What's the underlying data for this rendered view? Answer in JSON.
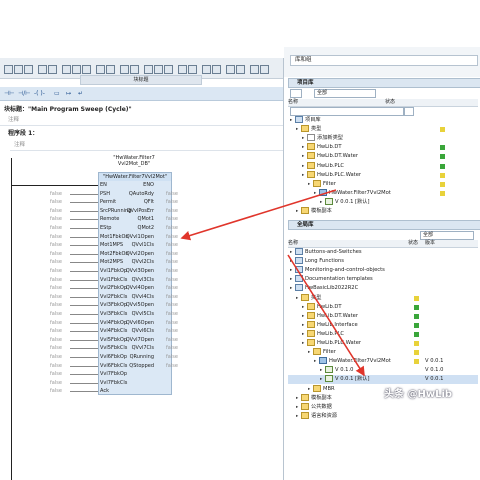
{
  "left_panel": {
    "block_header_label": "块标题",
    "block_title": "块标题：\"Main Program Sweep (Cycle)\"",
    "block_comment": "注释",
    "network_title": "程序段 1：",
    "network_comment": "注释",
    "instance_db_line1": "\"HwWater.Filter7",
    "instance_db_line2": "Vvl2Mot_DB\"",
    "fb_name": "\"HwWater.Filter7Vvl2Mot\"",
    "left_pins": [
      {
        "name": "EN",
        "value": ""
      },
      {
        "name": "PSH",
        "value": "false"
      },
      {
        "name": "Permit",
        "value": "false"
      },
      {
        "name": "SrcPRunning",
        "value": "false"
      },
      {
        "name": "Remote",
        "value": "false"
      },
      {
        "name": "EStp",
        "value": "false"
      },
      {
        "name": "Mot1FbkOn",
        "value": "false"
      },
      {
        "name": "Mot1MPS",
        "value": "false"
      },
      {
        "name": "Mot2FbkOn",
        "value": "false"
      },
      {
        "name": "Mot2MPS",
        "value": "false"
      },
      {
        "name": "Vvl1FbkOp",
        "value": "false"
      },
      {
        "name": "Vvl1FbkCls",
        "value": "false"
      },
      {
        "name": "Vvl2FbkOp",
        "value": "false"
      },
      {
        "name": "Vvl2FbkCls",
        "value": "false"
      },
      {
        "name": "Vvl3FbkOp",
        "value": "false"
      },
      {
        "name": "Vvl3FbkCls",
        "value": "false"
      },
      {
        "name": "Vvl4FbkOp",
        "value": "false"
      },
      {
        "name": "Vvl4FbkCls",
        "value": "false"
      },
      {
        "name": "Vvl5FbkOp",
        "value": "false"
      },
      {
        "name": "Vvl5FbkCls",
        "value": "false"
      },
      {
        "name": "Vvl6FbkOp",
        "value": "false"
      },
      {
        "name": "Vvl6FbkCls",
        "value": "false"
      },
      {
        "name": "Vvl7FbkOp",
        "value": "false"
      },
      {
        "name": "Vvl7FbkCls",
        "value": "false"
      },
      {
        "name": "Ack",
        "value": "false"
      }
    ],
    "right_pins": [
      {
        "name": "ENO",
        "value": ""
      },
      {
        "name": "QAutoRdy",
        "value": "false"
      },
      {
        "name": "QFlt",
        "value": "false"
      },
      {
        "name": "QVvlPosErr",
        "value": "false"
      },
      {
        "name": "QMot1",
        "value": "false"
      },
      {
        "name": "QMot2",
        "value": "false"
      },
      {
        "name": "QVvl1Open",
        "value": "false"
      },
      {
        "name": "QVvl1Cls",
        "value": "false"
      },
      {
        "name": "QVvl2Open",
        "value": "false"
      },
      {
        "name": "QVvl2Cls",
        "value": "false"
      },
      {
        "name": "QVvl3Open",
        "value": "false"
      },
      {
        "name": "QVvl3Cls",
        "value": "false"
      },
      {
        "name": "QVvl4Open",
        "value": "false"
      },
      {
        "name": "QVvl4Cls",
        "value": "false"
      },
      {
        "name": "QVvl5Open",
        "value": "false"
      },
      {
        "name": "QVvl5Cls",
        "value": "false"
      },
      {
        "name": "QVvl6Open",
        "value": "false"
      },
      {
        "name": "QVvl6Cls",
        "value": "false"
      },
      {
        "name": "QVvl7Open",
        "value": "false"
      },
      {
        "name": "QVvl7Cls",
        "value": "false"
      },
      {
        "name": "QRunning",
        "value": "false"
      },
      {
        "name": "QStopped",
        "value": "false"
      }
    ]
  },
  "right_panel": {
    "title": "库和组",
    "project_lib_header": "项目库",
    "project_lib_select": "全部",
    "col_name": "名称",
    "col_status": "状态",
    "project_tree": [
      {
        "label": "项目库",
        "icon": "lib",
        "status": ""
      },
      {
        "label": "类型",
        "icon": "folder",
        "status": "yellow"
      },
      {
        "label": "添加新类型",
        "icon": "page",
        "status": ""
      },
      {
        "label": "HwLib.DT",
        "icon": "folder",
        "status": "green"
      },
      {
        "label": "HwLib.DT.Water",
        "icon": "folder",
        "status": "green"
      },
      {
        "label": "HwLib.PLC",
        "icon": "folder",
        "status": "green"
      },
      {
        "label": "HwLib.PLC.Water",
        "icon": "folder",
        "status": "yellow"
      },
      {
        "label": "Filter",
        "icon": "folder",
        "status": "yellow"
      },
      {
        "label": "HwWater.Filter7Vvl2Mot",
        "icon": "block",
        "status": "yellow"
      },
      {
        "label": "V 0.0.1 [默认]",
        "icon": "ver",
        "status": ""
      },
      {
        "label": "模板副本",
        "icon": "folder",
        "status": ""
      }
    ],
    "global_lib_header": "全局库",
    "global_lib_select": "全部",
    "col_version": "版本",
    "global_tree": [
      {
        "label": "Buttons-and-Switches",
        "icon": "lib",
        "status": "",
        "version": ""
      },
      {
        "label": "Long Functions",
        "icon": "lib",
        "status": "",
        "version": ""
      },
      {
        "label": "Monitoring-and-control-objects",
        "icon": "lib",
        "status": "",
        "version": ""
      },
      {
        "label": "Documentation templates",
        "icon": "lib",
        "status": "",
        "version": ""
      },
      {
        "label": "HwBasicLib2022R2C",
        "icon": "lib",
        "status": "",
        "version": ""
      },
      {
        "label": "类型",
        "icon": "folder",
        "status": "yellow",
        "version": ""
      },
      {
        "label": "HwLib.DT",
        "icon": "folder",
        "status": "green",
        "version": ""
      },
      {
        "label": "HwLib.DT.Water",
        "icon": "folder",
        "status": "green",
        "version": ""
      },
      {
        "label": "HwLib.Interface",
        "icon": "folder",
        "status": "green",
        "version": ""
      },
      {
        "label": "HwLib.PLC",
        "icon": "folder",
        "status": "green",
        "version": ""
      },
      {
        "label": "HwLib.PLC.Water",
        "icon": "folder",
        "status": "yellow",
        "version": ""
      },
      {
        "label": "Filter",
        "icon": "folder",
        "status": "yellow",
        "version": ""
      },
      {
        "label": "HwWater.Filter7Vvl2Mot",
        "icon": "block",
        "status": "yellow",
        "version": "V 0.0.1"
      },
      {
        "label": "V 0.1.0",
        "icon": "ver",
        "status": "",
        "version": "V 0.1.0"
      },
      {
        "label": "V 0.0.1 [默认]",
        "icon": "ver",
        "status": "",
        "version": "V 0.0.1"
      },
      {
        "label": "MBR",
        "icon": "folder",
        "status": "",
        "version": ""
      },
      {
        "label": "模板副本",
        "icon": "folder",
        "status": "",
        "version": ""
      },
      {
        "label": "公共数据",
        "icon": "folder",
        "status": "",
        "version": ""
      },
      {
        "label": "语言和资源",
        "icon": "folder",
        "status": "",
        "version": ""
      }
    ]
  },
  "watermark": "头条 @HwLib",
  "colors": {
    "arrow": "#e0352b",
    "accent": "#1e4e8c",
    "status_green": "#3aa63a",
    "status_yellow": "#e8d23a"
  }
}
